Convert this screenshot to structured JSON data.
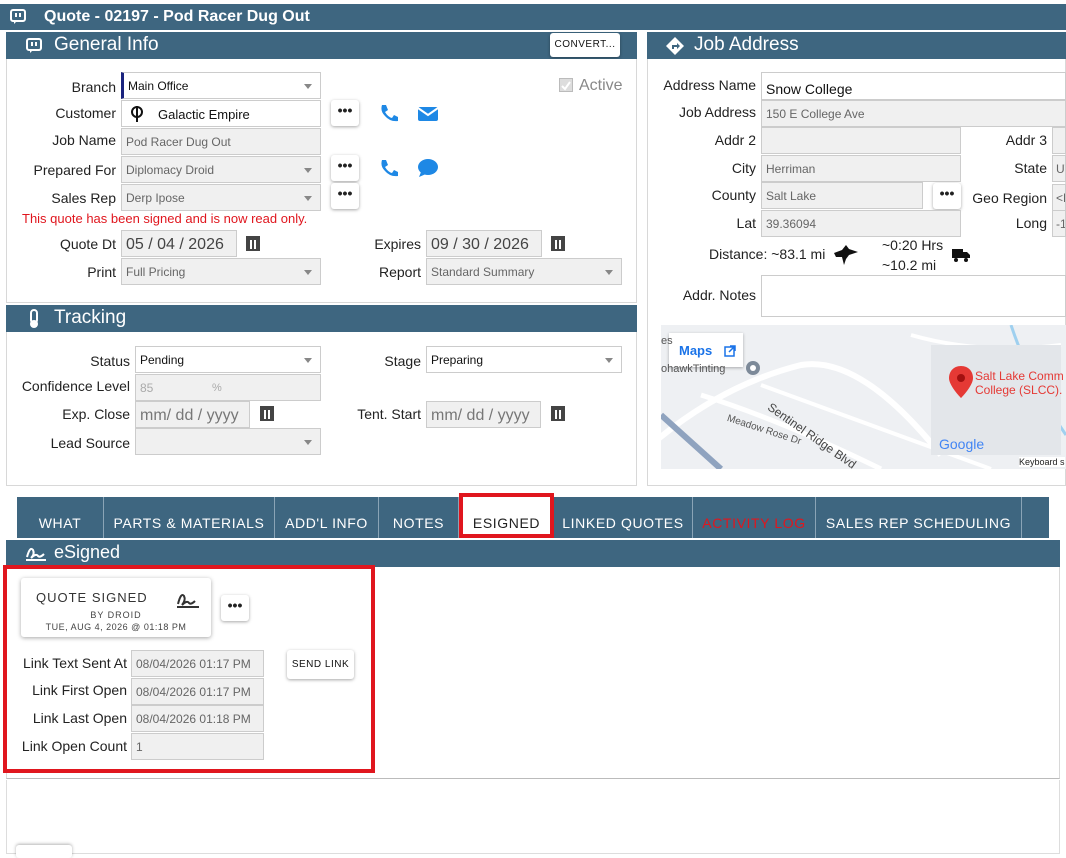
{
  "window": {
    "title": "Quote - 02197 - Pod Racer Dug Out"
  },
  "general": {
    "title": "General Info",
    "convert_label": "CONVERT...",
    "active_label": "Active",
    "branch_label": "Branch",
    "branch_value": "Main Office",
    "customer_label": "Customer",
    "customer_value": "Galactic Empire",
    "jobname_label": "Job Name",
    "jobname_value": "Pod Racer Dug Out",
    "preparedfor_label": "Prepared For",
    "preparedfor_value": "Diplomacy Droid",
    "salesrep_label": "Sales Rep",
    "salesrep_value": "Derp Ipose",
    "readonly_msg": "This quote has been signed and is now read only.",
    "quotedt_label": "Quote Dt",
    "quotedt_value": "05 / 04 / 2026",
    "expires_label": "Expires",
    "expires_value": "09 / 30 / 2026",
    "print_label": "Print",
    "print_value": "Full Pricing",
    "report_label": "Report",
    "report_value": "Standard Summary",
    "dots": "•••"
  },
  "job": {
    "title": "Job Address",
    "addrname_label": "Address Name",
    "addrname_value": "Snow College",
    "jobaddr_label": "Job Address",
    "jobaddr_value": "150 E College Ave",
    "addr2_label": "Addr 2",
    "addr2_value": "",
    "addr3_label": "Addr 3",
    "city_label": "City",
    "city_value": "Herriman",
    "state_label": "State",
    "state_value": "UT",
    "county_label": "County",
    "county_value": "Salt Lake",
    "georegion_label": "Geo Region",
    "georegion_value": "<E",
    "lat_label": "Lat",
    "lat_value": "39.36094",
    "long_label": "Long",
    "long_value": "-1",
    "distance_label": "Distance: ~83.1 mi",
    "drive_time": "~0:20 Hrs",
    "drive_dist": "~10.2 mi",
    "notes_label": "Addr. Notes",
    "map": {
      "maps_link": "Maps",
      "place_label_1": "Salt Lake Comm",
      "place_label_2": "College (SLCC).",
      "street_1": "Sentinel Ridge Blvd",
      "street_2": "Meadow Rose Dr",
      "poi": "ohawkTinting",
      "google": "Google",
      "keyboard": "Keyboard s",
      "left_edge": "es"
    }
  },
  "tracking": {
    "title": "Tracking",
    "status_label": "Status",
    "status_value": "Pending",
    "stage_label": "Stage",
    "stage_value": "Preparing",
    "confidence_label": "Confidence Level",
    "confidence_value": "85",
    "confidence_unit": "%",
    "expclose_label": "Exp. Close",
    "date_placeholder": "mm/ dd / yyyy",
    "tentstart_label": "Tent. Start",
    "leadsource_label": "Lead Source"
  },
  "tabs": [
    "WHAT",
    "PARTS & MATERIALS",
    "ADD'L INFO",
    "NOTES",
    "ESIGNED",
    "LINKED QUOTES",
    "ACTIVITY LOG",
    "SALES REP SCHEDULING"
  ],
  "esigned": {
    "title": "eSigned",
    "card_title": "QUOTE SIGNED",
    "card_by": "BY DROID",
    "card_date": "TUE, AUG 4, 2026 @ 01:18 PM",
    "send_link": "SEND LINK",
    "rows": [
      {
        "label": "Link Text Sent At",
        "value": "08/04/2026 01:17 PM"
      },
      {
        "label": "Link First Open",
        "value": "08/04/2026 01:17 PM"
      },
      {
        "label": "Link Last Open",
        "value": "08/04/2026 01:18 PM"
      },
      {
        "label": "Link Open Count",
        "value": "1"
      }
    ]
  },
  "colors": {
    "header": "#3e6680",
    "accent": "#1e88e5",
    "highlight": "#e0161e"
  }
}
